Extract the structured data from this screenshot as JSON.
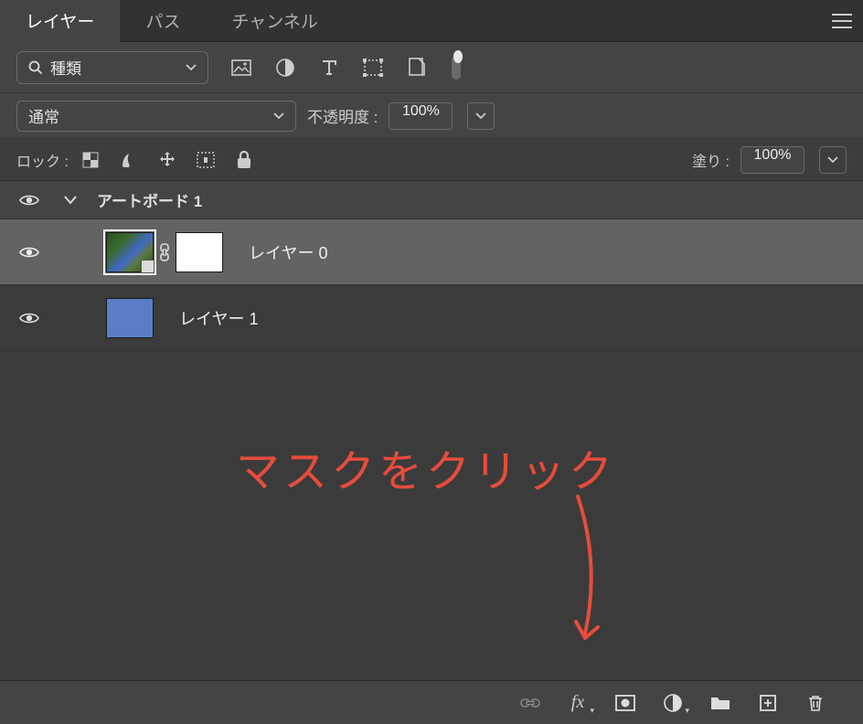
{
  "tabs": {
    "layers": "レイヤー",
    "paths": "パス",
    "channels": "チャンネル"
  },
  "filter": {
    "kind_label": "種類"
  },
  "blend": {
    "mode": "通常",
    "opacity_label": "不透明度 :",
    "opacity_value": "100%"
  },
  "lock": {
    "label": "ロック :",
    "fill_label": "塗り :",
    "fill_value": "100%"
  },
  "artboard": {
    "name": "アートボード 1"
  },
  "layers": [
    {
      "name": "レイヤー 0"
    },
    {
      "name": "レイヤー 1"
    }
  ],
  "annotation": {
    "text": "マスクをクリック"
  }
}
